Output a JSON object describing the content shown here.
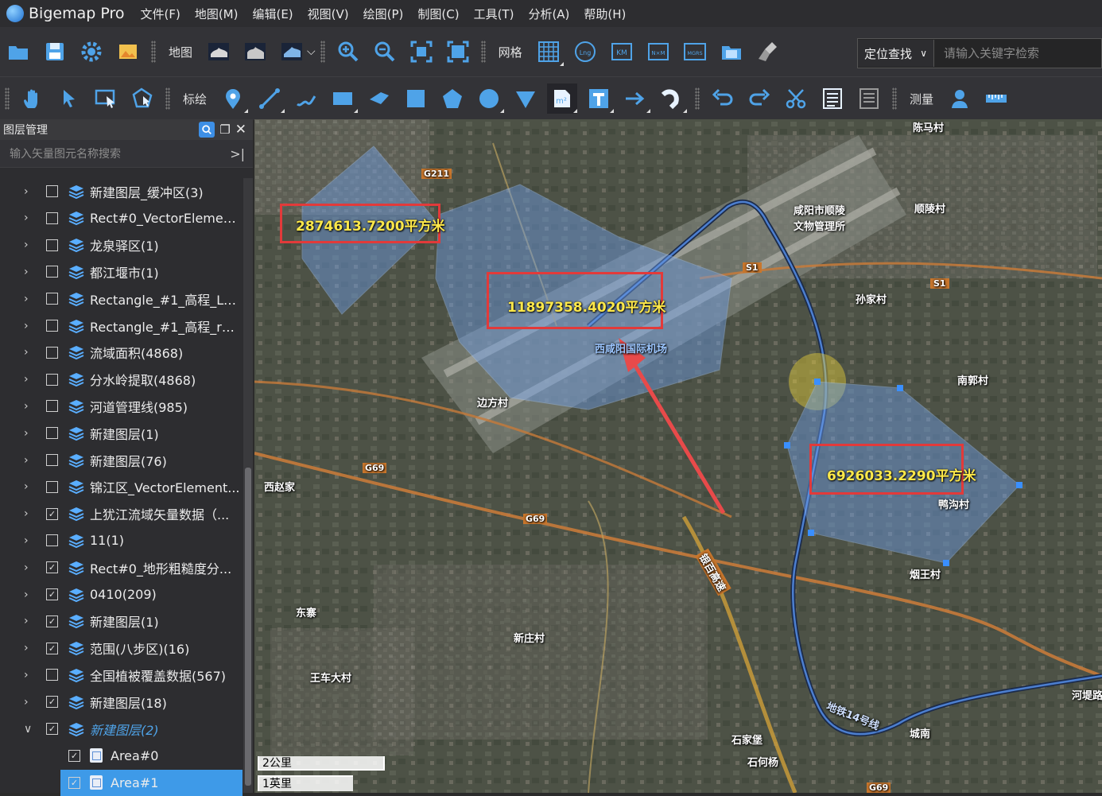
{
  "app": {
    "name": "Bigemap Pro"
  },
  "menu": [
    "文件(F)",
    "地图(M)",
    "编辑(E)",
    "视图(V)",
    "绘图(P)",
    "制图(C)",
    "工具(T)",
    "分析(A)",
    "帮助(H)"
  ],
  "toolbar1": {
    "map_label": "地图",
    "grid_label": "网格"
  },
  "search": {
    "mode": "定位查找",
    "placeholder": "请输入关键字检索"
  },
  "toolbar2": {
    "draw_label": "标绘",
    "measure_label": "测量"
  },
  "layer_panel": {
    "title": "图层管理",
    "filter_placeholder": "输入矢量图元名称搜索",
    "layers": [
      {
        "label": "新建图层_缓冲区(3)",
        "checked": false
      },
      {
        "label": "Rect#0_VectorElemen...",
        "checked": false
      },
      {
        "label": "龙泉驿区(1)",
        "checked": false
      },
      {
        "label": "都江堰市(1)",
        "checked": false
      },
      {
        "label": "Rectangle_#1_高程_Le...",
        "checked": false
      },
      {
        "label": "Rectangle_#1_高程_ra...",
        "checked": false
      },
      {
        "label": "流域面积(4868)",
        "checked": false
      },
      {
        "label": "分水岭提取(4868)",
        "checked": false
      },
      {
        "label": "河道管理线(985)",
        "checked": false
      },
      {
        "label": "新建图层(1)",
        "checked": false
      },
      {
        "label": "新建图层(76)",
        "checked": false
      },
      {
        "label": "锦江区_VectorElement...",
        "checked": false
      },
      {
        "label": "上犹江流域矢量数据（...",
        "checked": true
      },
      {
        "label": "11(1)",
        "checked": false
      },
      {
        "label": "Rect#0_地形粗糙度分...",
        "checked": true
      },
      {
        "label": "0410(209)",
        "checked": true
      },
      {
        "label": "新建图层(1)",
        "checked": true
      },
      {
        "label": "范围(八步区)(16)",
        "checked": true
      },
      {
        "label": "全国植被覆盖数据(567)",
        "checked": false
      },
      {
        "label": "新建图层(18)",
        "checked": true
      },
      {
        "label": "新建图层(2)",
        "checked": true
      }
    ],
    "children": [
      {
        "label": "Area#0",
        "checked": true
      },
      {
        "label": "Area#1",
        "checked": true
      }
    ]
  },
  "map": {
    "area_labels": [
      "2874613.7200平方米",
      "11897358.4020平方米",
      "6926033.2290平方米"
    ],
    "places": [
      "陈马村",
      "咸阳市顺陵",
      "文物管理所",
      "顺陵村",
      "孙家村",
      "南郭村",
      "边方村",
      "西咸阳国际机场",
      "西赵家",
      "鸭沟村",
      "烟王村",
      "东寨",
      "新庄村",
      "王车大村",
      "石家堡",
      "石何杨",
      "城南",
      "河堤路",
      "地铁14号线",
      "银百高速"
    ],
    "road_shields": [
      "G211",
      "S1",
      "S1",
      "G69",
      "G69",
      "G69"
    ],
    "scale": {
      "km": "2公里",
      "mi": "1英里"
    }
  },
  "colors": {
    "accent": "#3e9ae8",
    "label_text": "#fde84a",
    "highlight_box": "#e23a3a",
    "polygon_fill": "#6f9fe8"
  }
}
